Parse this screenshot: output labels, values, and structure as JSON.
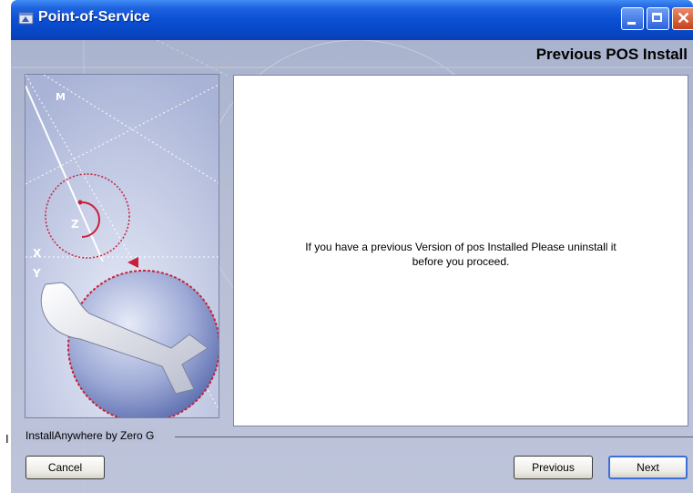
{
  "window": {
    "title": "Point-of-Service",
    "heading": "Previous POS Install"
  },
  "content": {
    "message_line1": "If you have a previous Version of  pos Installed Please uninstall it",
    "message_line2": "before you proceed."
  },
  "side_image": {
    "labels": {
      "m": "M",
      "z": "Z",
      "x": "X",
      "y": "Y"
    }
  },
  "footer": {
    "brand": "InstallAnywhere by Zero G",
    "cancel_label": "Cancel",
    "previous_label": "Previous",
    "next_label": "Next"
  },
  "icons": {
    "app": "installer-icon",
    "minimize": "minimize-icon",
    "maximize": "maximize-icon",
    "close": "close-icon"
  },
  "colors": {
    "titlebar": "#0a4fd4",
    "close_button": "#c4421c",
    "dialog_background": "#b7bed6"
  },
  "stray_mark": "I"
}
